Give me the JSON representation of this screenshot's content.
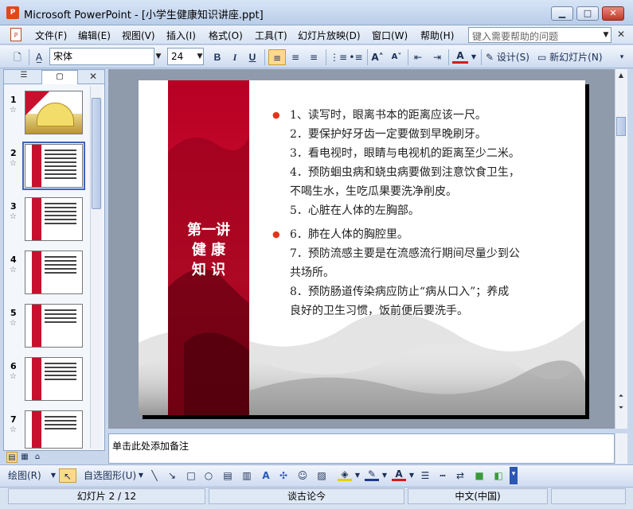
{
  "window": {
    "app_name": "Microsoft PowerPoint",
    "title": "Microsoft PowerPoint - [小学生健康知识讲座.ppt]",
    "minimize": "▁",
    "maximize": "□",
    "close": "✕"
  },
  "menu": {
    "items": [
      "文件(F)",
      "编辑(E)",
      "视图(V)",
      "插入(I)",
      "格式(O)",
      "工具(T)",
      "幻灯片放映(D)",
      "窗口(W)",
      "帮助(H)"
    ],
    "help_placeholder": "键入需要帮助的问题",
    "close": "✕"
  },
  "toolbar": {
    "font_name": "宋体",
    "font_size": "24",
    "bold": "B",
    "italic": "I",
    "underline": "U",
    "font_color": "A",
    "design": "设计(S)",
    "new_slide": "新幻灯片(N)"
  },
  "slides_panel": {
    "close": "✕",
    "slides": [
      {
        "num": "1"
      },
      {
        "num": "2"
      },
      {
        "num": "3"
      },
      {
        "num": "4"
      },
      {
        "num": "5"
      },
      {
        "num": "6"
      },
      {
        "num": "7"
      }
    ],
    "selected": 2
  },
  "slide": {
    "title_lines": [
      "第一讲",
      "健 康",
      "知 识"
    ],
    "lines": [
      {
        "bullet": true,
        "text": "1、读写时，眼离书本的距离应该一尺。"
      },
      {
        "bullet": false,
        "text": "2．要保护好牙齿一定要做到早晚刷牙。"
      },
      {
        "bullet": false,
        "text": "3．看电视时，眼睛与电视机的距离至少二米。"
      },
      {
        "bullet": false,
        "text": "4．预防蛔虫病和蛲虫病要做到注意饮食卫生，"
      },
      {
        "bullet": false,
        "text": "不喝生水，生吃瓜果要洗净削皮。"
      },
      {
        "bullet": false,
        "text": "5．心脏在人体的左胸部。"
      },
      {
        "bullet": true,
        "text": "6．肺在人体的胸腔里。"
      },
      {
        "bullet": false,
        "text": "7．预防流感主要是在流感流行期间尽量少到公"
      },
      {
        "bullet": false,
        "text": "共场所。"
      },
      {
        "bullet": false,
        "text": "8．预防肠道传染病应防止“病从口入”；养成"
      },
      {
        "bullet": false,
        "text": "良好的卫生习惯，饭前便后要洗手。"
      }
    ],
    "accent": "#c8102e"
  },
  "notes": {
    "placeholder": "单击此处添加备注"
  },
  "drawing_toolbar": {
    "draw": "绘图(R)",
    "autoshapes": "自选图形(U)"
  },
  "status": {
    "slide_pos": "幻灯片 2 / 12",
    "design": "谈古论今",
    "language": "中文(中国)"
  }
}
